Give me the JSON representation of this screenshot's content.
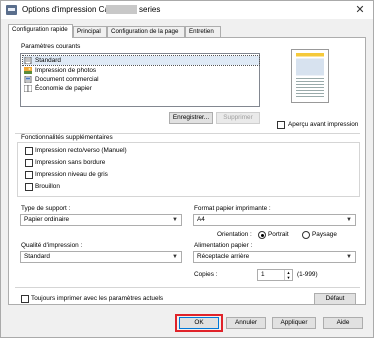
{
  "window": {
    "title_prefix": "Options d'impression Canon",
    "title_suffix": "series",
    "close_glyph": "✕"
  },
  "tabs": [
    {
      "label": "Configuration rapide"
    },
    {
      "label": "Principal"
    },
    {
      "label": "Configuration de la page"
    },
    {
      "label": "Entretien"
    }
  ],
  "presets": {
    "label": "Paramètres courants",
    "items": [
      {
        "label": "Standard",
        "icon": "document-standard-icon"
      },
      {
        "label": "Impression de photos",
        "icon": "photo-icon"
      },
      {
        "label": "Document commercial",
        "icon": "document-business-icon"
      },
      {
        "label": "Économie de papier",
        "icon": "paper-saving-icon"
      }
    ],
    "save_label": "Enregistrer...",
    "delete_label": "Supprimer"
  },
  "preview": {
    "checkbox_label": "Aperçu avant impression"
  },
  "features": {
    "label": "Fonctionnalités supplémentaires",
    "items": [
      {
        "label": "Impression recto/verso (Manuel)"
      },
      {
        "label": "Impression sans bordure"
      },
      {
        "label": "Impression niveau de gris"
      },
      {
        "label": "Brouillon"
      }
    ]
  },
  "media_type": {
    "label": "Type de support :",
    "value": "Papier ordinaire"
  },
  "paper_size": {
    "label": "Format papier imprimante :",
    "value": "A4"
  },
  "orientation": {
    "label": "Orientation :",
    "portrait": "Portrait",
    "landscape": "Paysage"
  },
  "print_quality": {
    "label": "Qualité d'impression :",
    "value": "Standard"
  },
  "paper_source": {
    "label": "Alimentation papier :",
    "value": "Réceptacle arrière"
  },
  "copies": {
    "label": "Copies :",
    "value": "1",
    "range": "(1-999)"
  },
  "always_print": {
    "label": "Toujours imprimer avec les paramètres actuels"
  },
  "buttons": {
    "default": "Défaut",
    "ok": "OK",
    "cancel": "Annuler",
    "apply": "Appliquer",
    "help": "Aide"
  },
  "colors": {
    "highlight": "#e0232a",
    "selection": "#dfeaf6"
  }
}
